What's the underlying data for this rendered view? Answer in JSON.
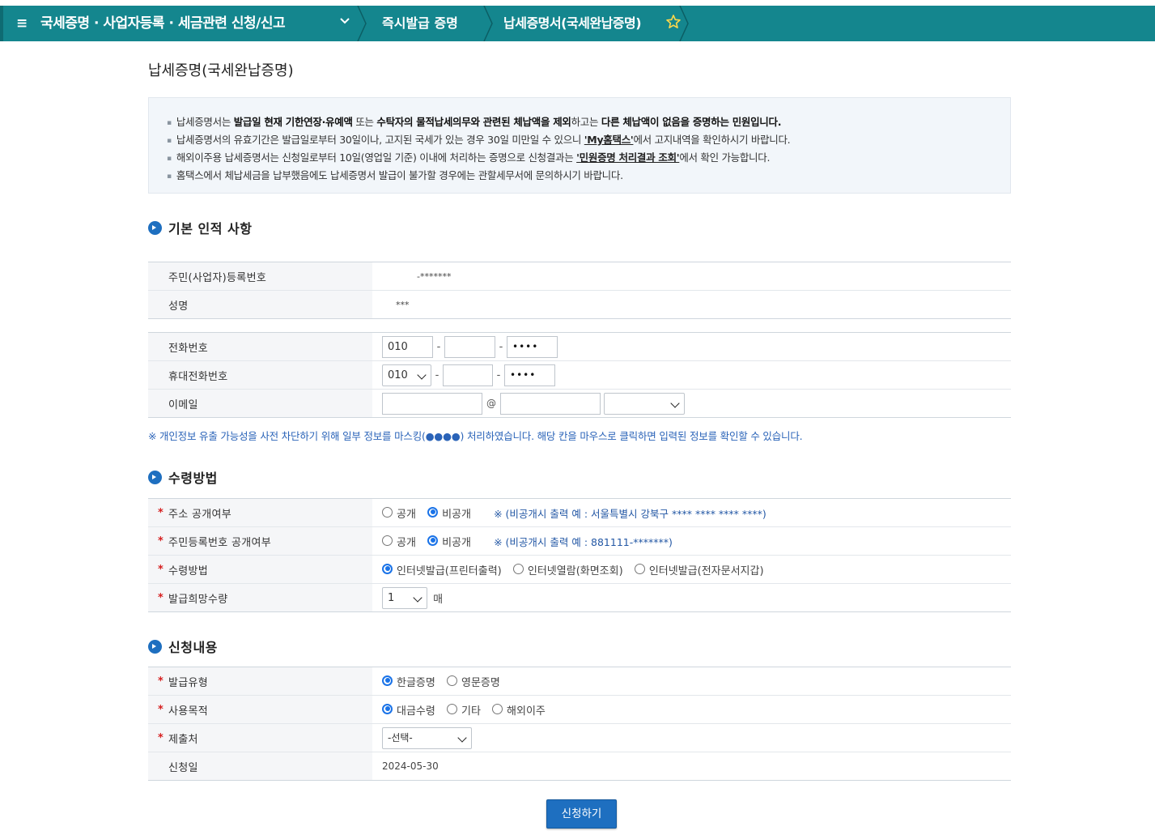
{
  "nav": {
    "menu_glyph": "≡",
    "category": "국세증명 · 사업자등록 · 세금관련 신청/신고",
    "chevron": "⌄",
    "sub": "즉시발급 증명",
    "current": "납세증명서(국세완납증명)",
    "color": "#14868e"
  },
  "page": {
    "title": "납세증명(국세완납증명)"
  },
  "notice": {
    "line1": {
      "a": "납세증명서는 ",
      "b1": "발급일 현재 기한연장·유예액",
      "c": " 또는 ",
      "b2": "수탁자의 물적납세의무와 관련된 체납액을 제외",
      "d": "하고는 ",
      "b3": "다른 체납액이 없음을 증명하는 민원입니다."
    },
    "line2": {
      "a": "납세증명서의 유효기간은 발급일로부터 30일이나, 고지된 국세가 있는 경우 30일 미만일 수 있으니 ",
      "link": "'My홈택스'",
      "b": "에서 고지내역을 확인하시기 바랍니다."
    },
    "line3": {
      "a": "해외이주용 납세증명서는 신청일로부터 10일(영업일 기준) 이내에 처리하는 증명으로 신청결과는 ",
      "link": "'민원증명 처리결과 조회'",
      "b": "에서 확인 가능합니다."
    },
    "line4": "홈택스에서 체납세금을 납부했음에도 납세증명서 발급이 불가할 경우에는 관할세무서에 문의하시기 바랍니다."
  },
  "section_basic": {
    "title": "기본 인적 사항",
    "id_label": "주민(사업자)등록번호",
    "id_value": "-*******",
    "name_label": "성명",
    "name_value": "***"
  },
  "contact": {
    "phone_label": "전화번호",
    "phone_1": "010",
    "phone_2": "",
    "phone_3": "••••",
    "mobile_label": "휴대전화번호",
    "mobile_1": "010",
    "mobile_2": "",
    "mobile_3": "••••",
    "email_label": "이메일",
    "email_user": "",
    "email_at": "@",
    "email_domain": "",
    "email_select": "",
    "dash": "-"
  },
  "mask_note": "※ 개인정보 유출 가능성을 사전 차단하기 위해 일부 정보를 마스킹(●●●●) 처리하였습니다. 해당 칸을 마우스로 클릭하면 입력된 정보를 확인할 수 있습니다.",
  "section_receive": {
    "title": "수령방법",
    "addr_label": "주소 공개여부",
    "addr_public": "공개",
    "addr_private": "비공개",
    "addr_hint": "※ (비공개시 출력 예 : 서울특별시 강북구 **** **** **** ****)",
    "rrn_label": "주민등록번호 공개여부",
    "rrn_public": "공개",
    "rrn_private": "비공개",
    "rrn_hint": "※ (비공개시 출력 예 : 881111-*******)",
    "method_label": "수령방법",
    "method_1": "인터넷발급(프린터출력)",
    "method_2": "인터넷열람(화면조회)",
    "method_3": "인터넷발급(전자문서지갑)",
    "qty_label": "발급희망수량",
    "qty_value": "1",
    "qty_unit": "매"
  },
  "section_apply": {
    "title": "신청내용",
    "type_label": "발급유형",
    "type_1": "한글증명",
    "type_2": "영문증명",
    "purpose_label": "사용목적",
    "purpose_1": "대금수령",
    "purpose_2": "기타",
    "purpose_3": "해외이주",
    "submit_to_label": "제출처",
    "submit_to_value": "-선택-",
    "date_label": "신청일",
    "date_value": "2024-05-30"
  },
  "submit_label": "신청하기"
}
